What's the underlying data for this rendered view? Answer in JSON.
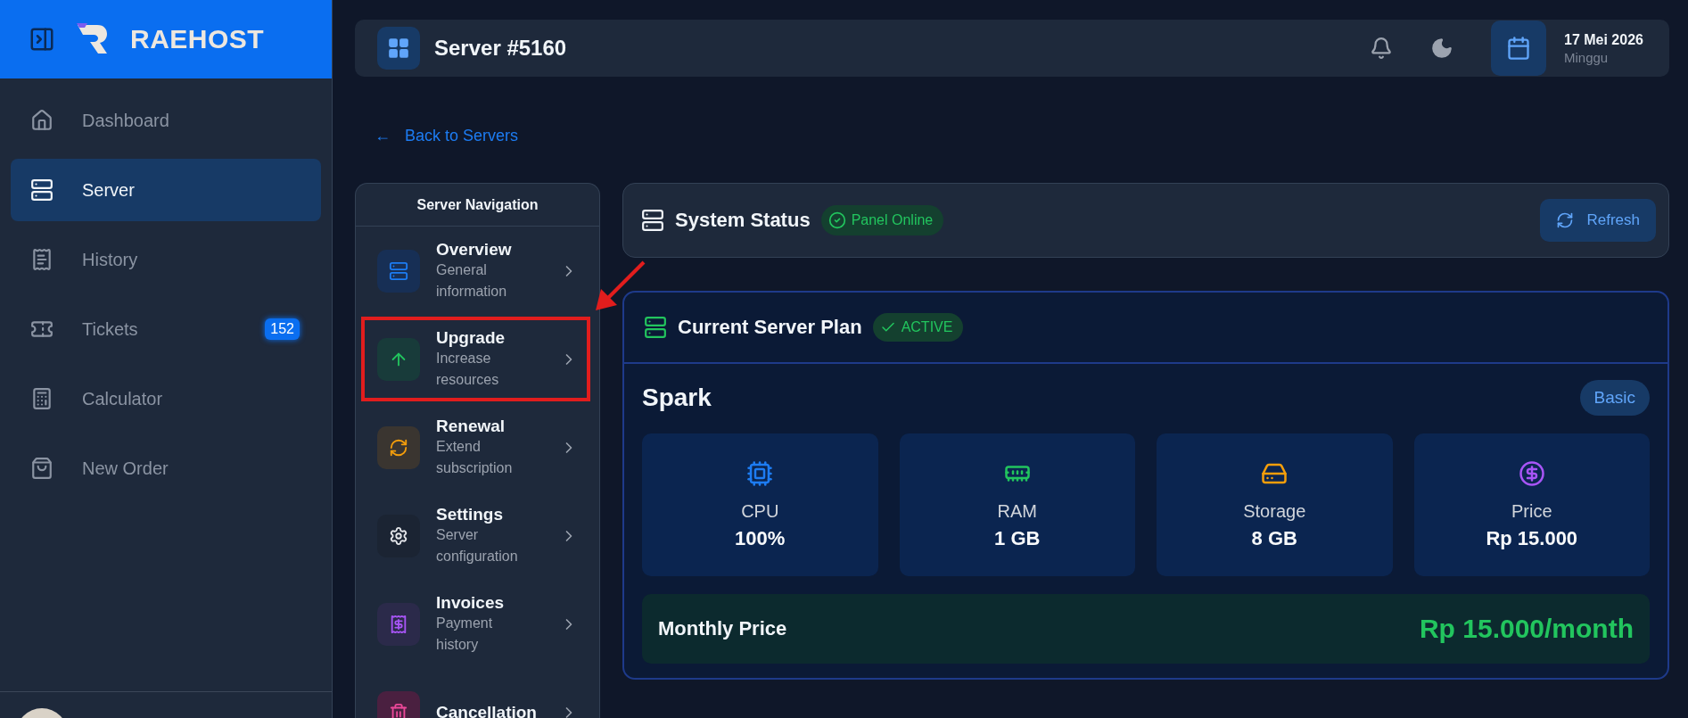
{
  "brand": {
    "name": "RAEHOST"
  },
  "sidebar": {
    "items": [
      {
        "label": "Dashboard",
        "selected": false
      },
      {
        "label": "Server",
        "selected": true
      },
      {
        "label": "History",
        "selected": false
      },
      {
        "label": "Tickets",
        "selected": false,
        "badge": "152"
      },
      {
        "label": "Calculator",
        "selected": false
      },
      {
        "label": "New Order",
        "selected": false
      }
    ]
  },
  "topbar": {
    "title": "Server #5160",
    "date": "17 Mei 2026",
    "day": "Minggu"
  },
  "back_link": {
    "arrow": "←",
    "label": "Back to Servers"
  },
  "server_nav": {
    "title": "Server Navigation",
    "items": [
      {
        "title": "Overview",
        "subtitle": "General information",
        "highlighted": false
      },
      {
        "title": "Upgrade",
        "subtitle": "Increase resources",
        "highlighted": true
      },
      {
        "title": "Renewal",
        "subtitle": "Extend subscription",
        "highlighted": false
      },
      {
        "title": "Settings",
        "subtitle": "Server configuration",
        "highlighted": false
      },
      {
        "title": "Invoices",
        "subtitle": "Payment history",
        "highlighted": false
      },
      {
        "title": "Cancellation",
        "highlighted": false
      }
    ]
  },
  "system_status": {
    "title": "System Status",
    "status": "Panel Online",
    "refresh": "Refresh"
  },
  "plan": {
    "title": "Current Server Plan",
    "status": "ACTIVE",
    "name": "Spark",
    "tier": "Basic",
    "specs": [
      {
        "label": "CPU",
        "value": "100%"
      },
      {
        "label": "RAM",
        "value": "1 GB"
      },
      {
        "label": "Storage",
        "value": "8 GB"
      },
      {
        "label": "Price",
        "value": "Rp 15.000"
      }
    ],
    "monthly_label": "Monthly Price",
    "monthly_value": "Rp 15.000/month"
  }
}
